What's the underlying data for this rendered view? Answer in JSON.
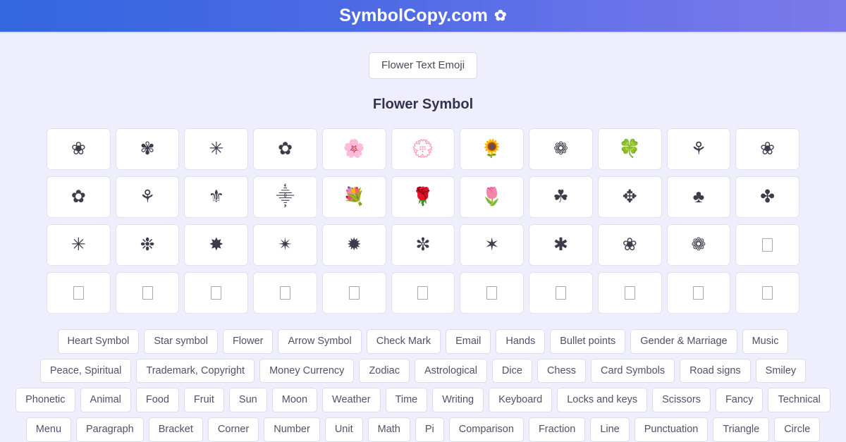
{
  "header": {
    "title": "SymbolCopy.com",
    "brand_icon": "flower-icon",
    "brand_glyph": "✿",
    "gradient_from": "#3366e0",
    "gradient_to": "#7b7aeb"
  },
  "toolbar": {
    "emoji_tab_label": "Flower Text Emoji"
  },
  "main": {
    "section_title": "Flower Symbol",
    "symbol_rows": [
      [
        {
          "glyph": "❀",
          "name": "white-florette"
        },
        {
          "glyph": "✾",
          "name": "six-petalled-black-and-white-florette"
        },
        {
          "glyph": "✳",
          "name": "eight-spoked-asterisk"
        },
        {
          "glyph": "✿",
          "name": "black-florette"
        },
        {
          "glyph": "🌸",
          "name": "cherry-blossom"
        },
        {
          "glyph": "💮",
          "name": "white-flower"
        },
        {
          "glyph": "🌻",
          "name": "sunflower"
        },
        {
          "glyph": "❁",
          "name": "black-florette-outlined"
        },
        {
          "glyph": "🍀",
          "name": "four-leaf-clover"
        },
        {
          "glyph": "⚘",
          "name": "flower-sign"
        },
        {
          "glyph": "❀",
          "name": "white-florette-repeat"
        }
      ],
      [
        {
          "glyph": "✿",
          "name": "black-florette-2"
        },
        {
          "glyph": "⚘",
          "name": "flower-2"
        },
        {
          "glyph": "⚜",
          "name": "fleur-de-lis"
        },
        {
          "glyph": "⸎",
          "name": "editorial-coronis"
        },
        {
          "glyph": "💐",
          "name": "bouquet"
        },
        {
          "glyph": "🌹",
          "name": "rose"
        },
        {
          "glyph": "🌷",
          "name": "tulip"
        },
        {
          "glyph": "☘",
          "name": "shamrock"
        },
        {
          "glyph": "✥",
          "name": "four-club-branched-outlined-cross"
        },
        {
          "glyph": "♣",
          "name": "black-club-suit"
        },
        {
          "glyph": "✤",
          "name": "heavy-four-balloon-spoked-asterisk"
        }
      ],
      [
        {
          "glyph": "✳",
          "name": "eight-spoked-asterisk-2"
        },
        {
          "glyph": "❉",
          "name": "balloon-spoked-asterisk"
        },
        {
          "glyph": "✸",
          "name": "eight-pointed-black-star-dotted"
        },
        {
          "glyph": "✴",
          "name": "eight-pointed-black-star"
        },
        {
          "glyph": "✹",
          "name": "twelve-pointed-black-star"
        },
        {
          "glyph": "✼",
          "name": "open-centre-teardrop-spoked-asterisk"
        },
        {
          "glyph": "✶",
          "name": "six-pointed-black-star"
        },
        {
          "glyph": "✱",
          "name": "heavy-asterisk"
        },
        {
          "glyph": "❀︎",
          "name": "bowtie-florette"
        },
        {
          "glyph": "❁︎",
          "name": "bowtie-florette-dotted"
        },
        {
          "glyph": "tofu",
          "name": "missing-glyph"
        }
      ],
      [
        {
          "glyph": "tofu",
          "name": "missing-glyph"
        },
        {
          "glyph": "tofu",
          "name": "missing-glyph"
        },
        {
          "glyph": "tofu",
          "name": "missing-glyph"
        },
        {
          "glyph": "tofu",
          "name": "missing-glyph"
        },
        {
          "glyph": "tofu",
          "name": "missing-glyph"
        },
        {
          "glyph": "tofu",
          "name": "missing-glyph"
        },
        {
          "glyph": "tofu",
          "name": "missing-glyph"
        },
        {
          "glyph": "tofu",
          "name": "missing-glyph"
        },
        {
          "glyph": "tofu",
          "name": "missing-glyph"
        },
        {
          "glyph": "tofu",
          "name": "missing-glyph"
        },
        {
          "glyph": "tofu",
          "name": "missing-glyph"
        }
      ]
    ]
  },
  "categories": {
    "rows": [
      [
        "Heart Symbol",
        "Star symbol",
        "Flower",
        "Arrow Symbol",
        "Check Mark",
        "Email",
        "Hands",
        "Bullet points",
        "Gender & Marriage",
        "Music"
      ],
      [
        "Peace, Spiritual",
        "Trademark, Copyright",
        "Money Currency",
        "Zodiac",
        "Astrological",
        "Dice",
        "Chess",
        "Card Symbols",
        "Road signs",
        "Smiley"
      ],
      [
        "Phonetic",
        "Animal",
        "Food",
        "Fruit",
        "Sun",
        "Moon",
        "Weather",
        "Time",
        "Writing",
        "Keyboard",
        "Locks and keys",
        "Scissors",
        "Fancy",
        "Technical"
      ],
      [
        "Menu",
        "Paragraph",
        "Bracket",
        "Corner",
        "Number",
        "Unit",
        "Math",
        "Pi",
        "Comparison",
        "Fraction",
        "Line",
        "Punctuation",
        "Triangle",
        "Circle"
      ]
    ]
  }
}
